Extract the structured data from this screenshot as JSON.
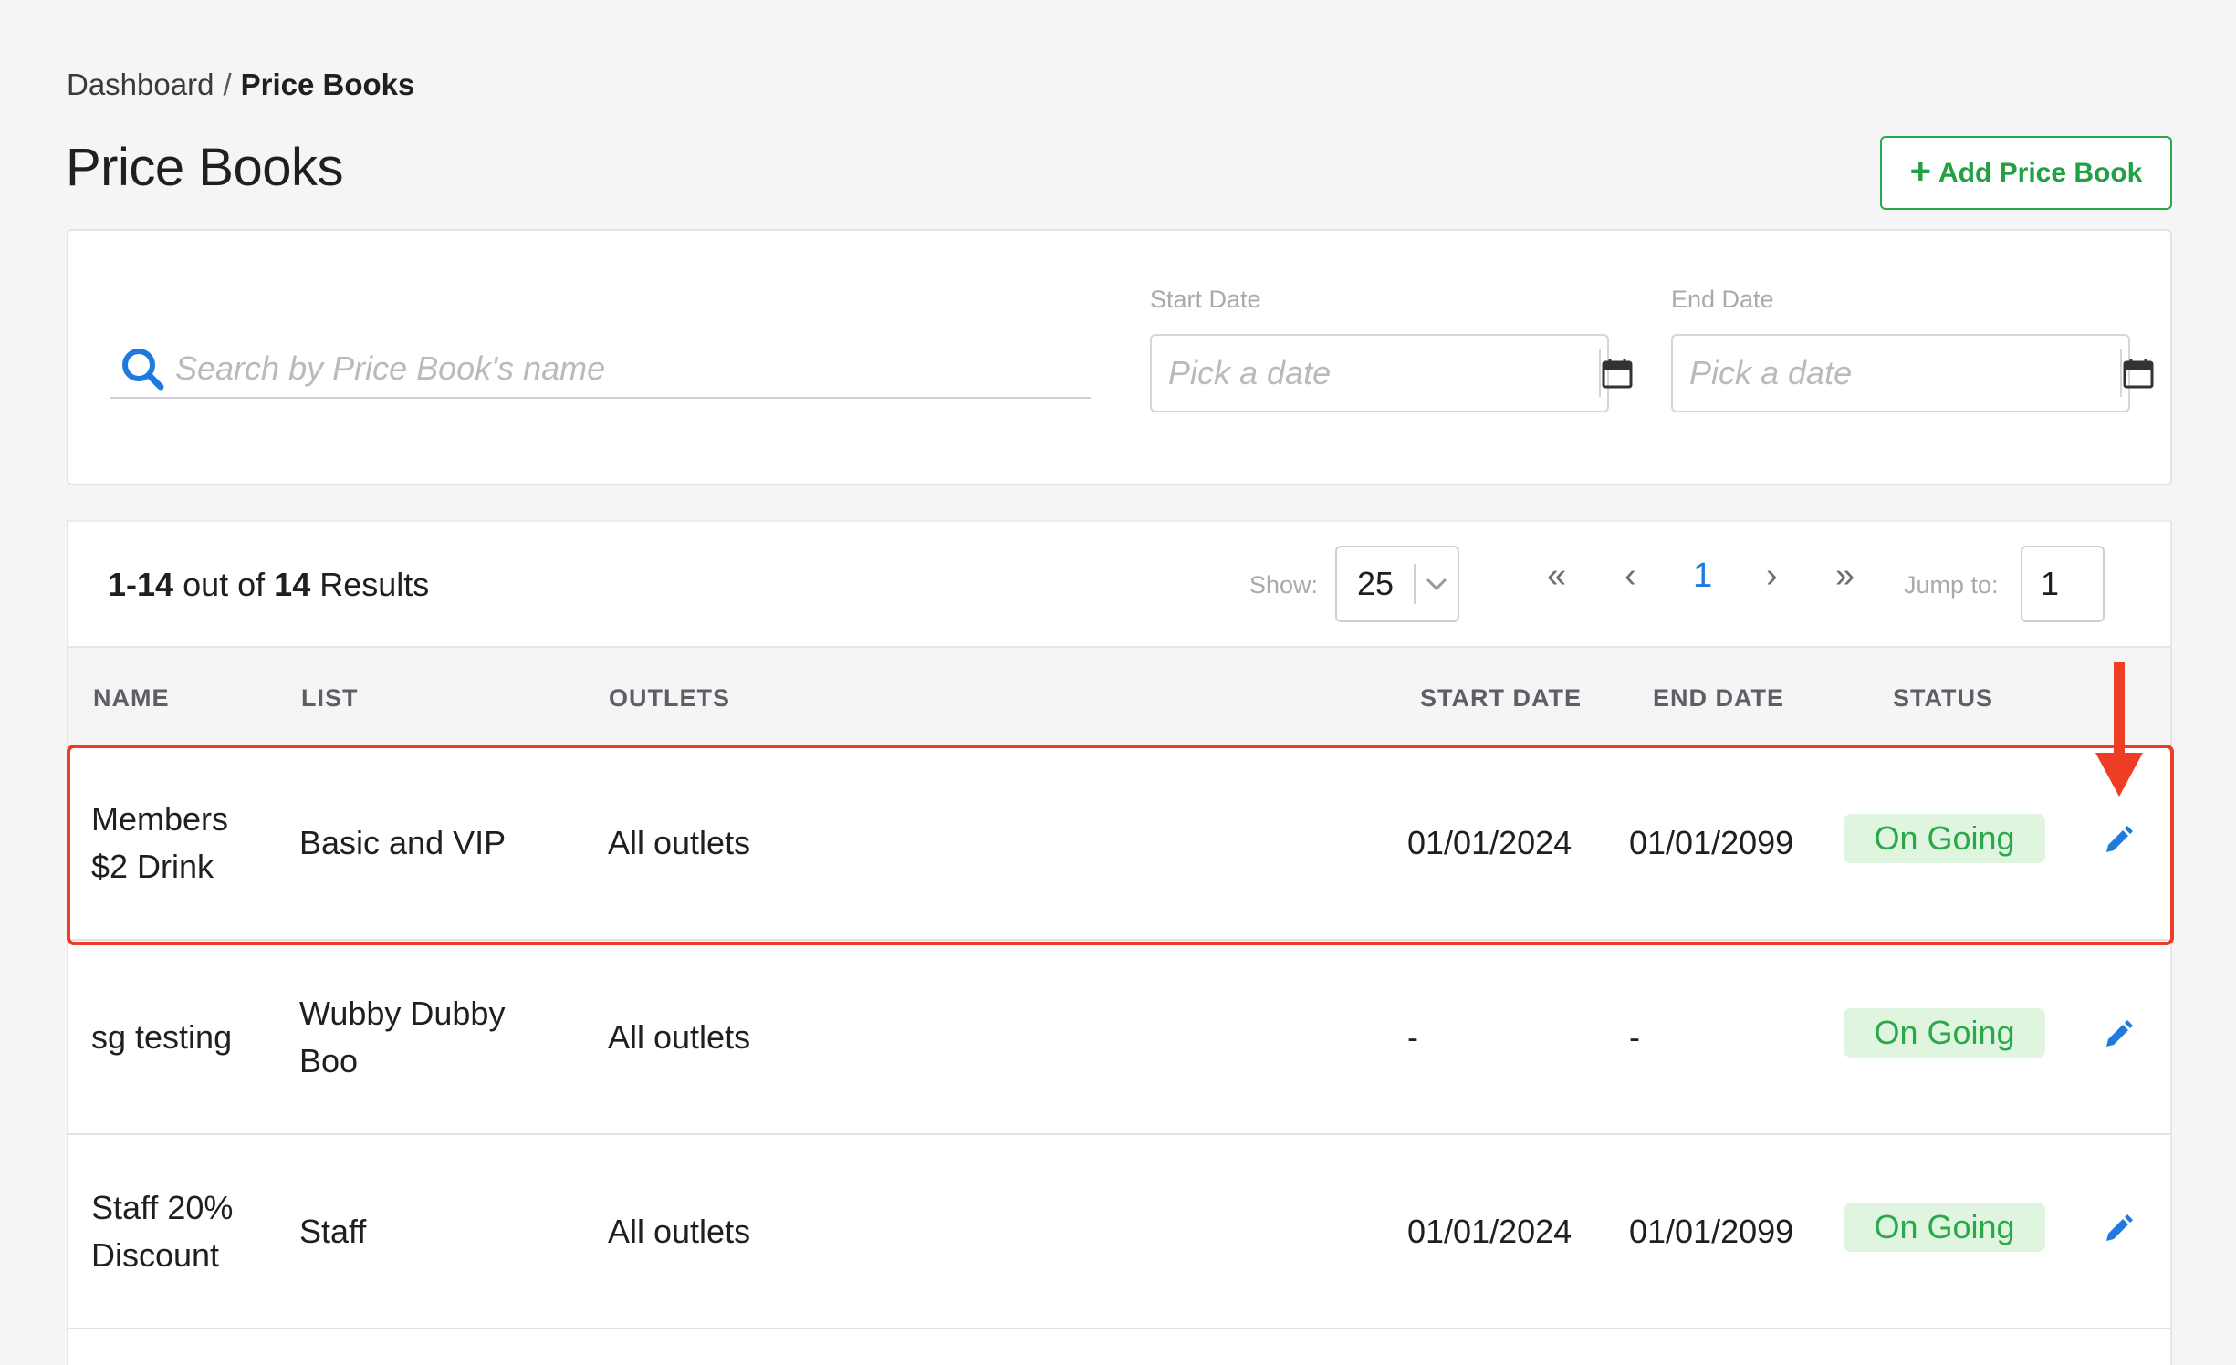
{
  "breadcrumb": {
    "root": "Dashboard",
    "separator": "/",
    "current": "Price Books"
  },
  "page_title": "Price Books",
  "add_button": {
    "label": "Add Price Book",
    "icon": "plus-icon"
  },
  "filters": {
    "search_placeholder": "Search by Price Book's name",
    "start_date_label": "Start Date",
    "start_date_placeholder": "Pick a date",
    "end_date_label": "End Date",
    "end_date_placeholder": "Pick a date"
  },
  "results": {
    "range": "1-14",
    "out_of": "out of",
    "total": "14",
    "suffix": "Results",
    "show_label": "Show:",
    "show_value": "25",
    "pager": {
      "first": "«",
      "prev": "‹",
      "current": "1",
      "next": "›",
      "last": "»"
    },
    "jump_label": "Jump to:",
    "jump_value": "1"
  },
  "table": {
    "headers": [
      "NAME",
      "LIST",
      "OUTLETS",
      "START DATE",
      "END DATE",
      "STATUS"
    ],
    "rows": [
      {
        "name_line1": "Members",
        "name_line2": "$2 Drink",
        "list_line1": "Basic and VIP",
        "list_line2": "",
        "outlets": "All outlets",
        "start": "01/01/2024",
        "end": "01/01/2099",
        "status": "On Going"
      },
      {
        "name_line1": "sg testing",
        "name_line2": "",
        "list_line1": "Wubby Dubby",
        "list_line2": "Boo",
        "outlets": "All outlets",
        "start": "-",
        "end": "-",
        "status": "On Going"
      },
      {
        "name_line1": "Staff 20%",
        "name_line2": "Discount",
        "list_line1": "Staff",
        "list_line2": "",
        "outlets": "All outlets",
        "start": "01/01/2024",
        "end": "01/01/2099",
        "status": "On Going"
      }
    ]
  },
  "colors": {
    "accent_green": "#2aa84a",
    "link_blue": "#1f7ae0",
    "highlight_red": "#ee3d25"
  }
}
